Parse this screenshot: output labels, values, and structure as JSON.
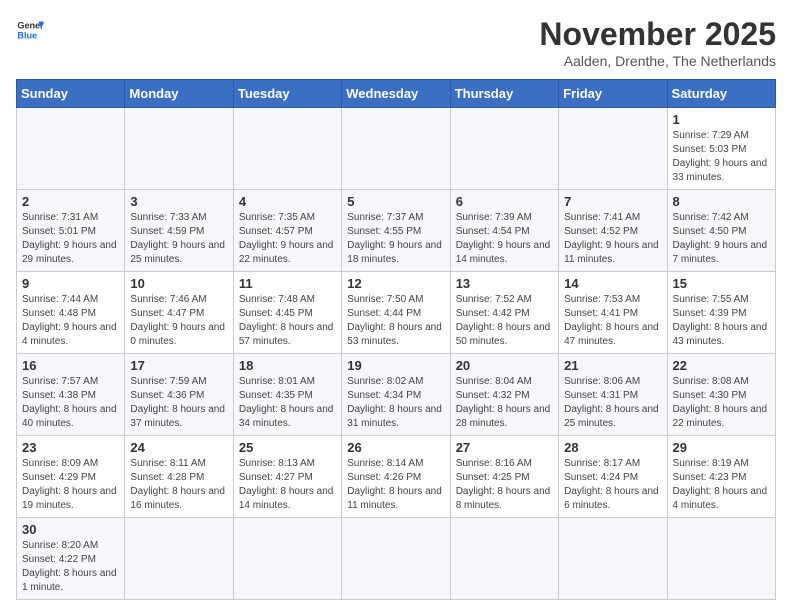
{
  "logo": {
    "line1": "General",
    "line2": "Blue"
  },
  "header": {
    "month": "November 2025",
    "location": "Aalden, Drenthe, The Netherlands"
  },
  "weekdays": [
    "Sunday",
    "Monday",
    "Tuesday",
    "Wednesday",
    "Thursday",
    "Friday",
    "Saturday"
  ],
  "weeks": [
    [
      {
        "day": "",
        "info": ""
      },
      {
        "day": "",
        "info": ""
      },
      {
        "day": "",
        "info": ""
      },
      {
        "day": "",
        "info": ""
      },
      {
        "day": "",
        "info": ""
      },
      {
        "day": "",
        "info": ""
      },
      {
        "day": "1",
        "info": "Sunrise: 7:29 AM\nSunset: 5:03 PM\nDaylight: 9 hours and 33 minutes."
      }
    ],
    [
      {
        "day": "2",
        "info": "Sunrise: 7:31 AM\nSunset: 5:01 PM\nDaylight: 9 hours and 29 minutes."
      },
      {
        "day": "3",
        "info": "Sunrise: 7:33 AM\nSunset: 4:59 PM\nDaylight: 9 hours and 25 minutes."
      },
      {
        "day": "4",
        "info": "Sunrise: 7:35 AM\nSunset: 4:57 PM\nDaylight: 9 hours and 22 minutes."
      },
      {
        "day": "5",
        "info": "Sunrise: 7:37 AM\nSunset: 4:55 PM\nDaylight: 9 hours and 18 minutes."
      },
      {
        "day": "6",
        "info": "Sunrise: 7:39 AM\nSunset: 4:54 PM\nDaylight: 9 hours and 14 minutes."
      },
      {
        "day": "7",
        "info": "Sunrise: 7:41 AM\nSunset: 4:52 PM\nDaylight: 9 hours and 11 minutes."
      },
      {
        "day": "8",
        "info": "Sunrise: 7:42 AM\nSunset: 4:50 PM\nDaylight: 9 hours and 7 minutes."
      }
    ],
    [
      {
        "day": "9",
        "info": "Sunrise: 7:44 AM\nSunset: 4:48 PM\nDaylight: 9 hours and 4 minutes."
      },
      {
        "day": "10",
        "info": "Sunrise: 7:46 AM\nSunset: 4:47 PM\nDaylight: 9 hours and 0 minutes."
      },
      {
        "day": "11",
        "info": "Sunrise: 7:48 AM\nSunset: 4:45 PM\nDaylight: 8 hours and 57 minutes."
      },
      {
        "day": "12",
        "info": "Sunrise: 7:50 AM\nSunset: 4:44 PM\nDaylight: 8 hours and 53 minutes."
      },
      {
        "day": "13",
        "info": "Sunrise: 7:52 AM\nSunset: 4:42 PM\nDaylight: 8 hours and 50 minutes."
      },
      {
        "day": "14",
        "info": "Sunrise: 7:53 AM\nSunset: 4:41 PM\nDaylight: 8 hours and 47 minutes."
      },
      {
        "day": "15",
        "info": "Sunrise: 7:55 AM\nSunset: 4:39 PM\nDaylight: 8 hours and 43 minutes."
      }
    ],
    [
      {
        "day": "16",
        "info": "Sunrise: 7:57 AM\nSunset: 4:38 PM\nDaylight: 8 hours and 40 minutes."
      },
      {
        "day": "17",
        "info": "Sunrise: 7:59 AM\nSunset: 4:36 PM\nDaylight: 8 hours and 37 minutes."
      },
      {
        "day": "18",
        "info": "Sunrise: 8:01 AM\nSunset: 4:35 PM\nDaylight: 8 hours and 34 minutes."
      },
      {
        "day": "19",
        "info": "Sunrise: 8:02 AM\nSunset: 4:34 PM\nDaylight: 8 hours and 31 minutes."
      },
      {
        "day": "20",
        "info": "Sunrise: 8:04 AM\nSunset: 4:32 PM\nDaylight: 8 hours and 28 minutes."
      },
      {
        "day": "21",
        "info": "Sunrise: 8:06 AM\nSunset: 4:31 PM\nDaylight: 8 hours and 25 minutes."
      },
      {
        "day": "22",
        "info": "Sunrise: 8:08 AM\nSunset: 4:30 PM\nDaylight: 8 hours and 22 minutes."
      }
    ],
    [
      {
        "day": "23",
        "info": "Sunrise: 8:09 AM\nSunset: 4:29 PM\nDaylight: 8 hours and 19 minutes."
      },
      {
        "day": "24",
        "info": "Sunrise: 8:11 AM\nSunset: 4:28 PM\nDaylight: 8 hours and 16 minutes."
      },
      {
        "day": "25",
        "info": "Sunrise: 8:13 AM\nSunset: 4:27 PM\nDaylight: 8 hours and 14 minutes."
      },
      {
        "day": "26",
        "info": "Sunrise: 8:14 AM\nSunset: 4:26 PM\nDaylight: 8 hours and 11 minutes."
      },
      {
        "day": "27",
        "info": "Sunrise: 8:16 AM\nSunset: 4:25 PM\nDaylight: 8 hours and 8 minutes."
      },
      {
        "day": "28",
        "info": "Sunrise: 8:17 AM\nSunset: 4:24 PM\nDaylight: 8 hours and 6 minutes."
      },
      {
        "day": "29",
        "info": "Sunrise: 8:19 AM\nSunset: 4:23 PM\nDaylight: 8 hours and 4 minutes."
      }
    ],
    [
      {
        "day": "30",
        "info": "Sunrise: 8:20 AM\nSunset: 4:22 PM\nDaylight: 8 hours and 1 minute."
      },
      {
        "day": "",
        "info": ""
      },
      {
        "day": "",
        "info": ""
      },
      {
        "day": "",
        "info": ""
      },
      {
        "day": "",
        "info": ""
      },
      {
        "day": "",
        "info": ""
      },
      {
        "day": "",
        "info": ""
      }
    ]
  ]
}
